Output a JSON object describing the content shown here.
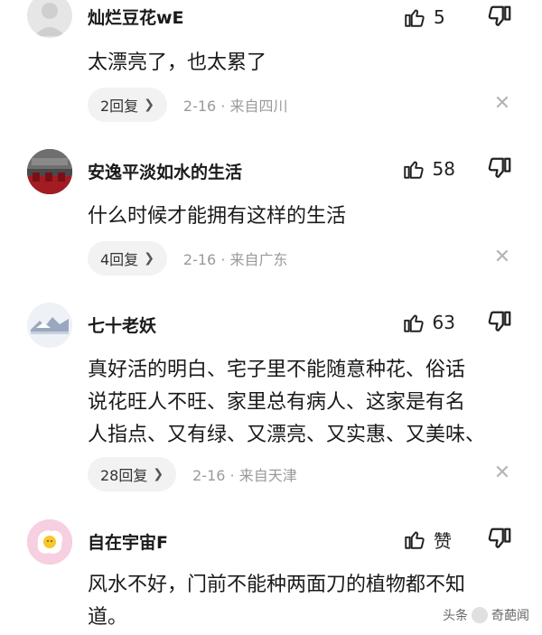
{
  "comments": [
    {
      "username": "灿烂豆花wE",
      "likes": "5",
      "text": [
        "太漂亮了，也太累了"
      ],
      "replies": "2回复",
      "date": "2-16",
      "location": "来自四川",
      "avatar": "gray-placeholder-avatar"
    },
    {
      "username": "安逸平淡如水的生活",
      "likes": "58",
      "text": [
        "什么时候才能拥有这样的生活"
      ],
      "replies": "4回复",
      "date": "2-16",
      "location": "来自广东",
      "avatar": "photo-avatar"
    },
    {
      "username": "七十老妖",
      "likes": "63",
      "text": [
        "真好活的明白、宅子里不能随意种花、俗话",
        "说花旺人不旺、家里总有病人、这家是有名",
        "人指点、又有绿、又漂亮、又实惠、又美味、"
      ],
      "replies": "28回复",
      "date": "2-16",
      "location": "来自天津",
      "avatar": "snow-landscape-avatar"
    },
    {
      "username": "自在宇宙F",
      "likes": "赞",
      "text": [
        "风水不好，门前不能种两面刀的植物都不知",
        "道。"
      ],
      "avatar": "fried-egg-avatar"
    }
  ],
  "separator": "·",
  "watermark": {
    "brand": "头条",
    "account": "奇葩闻"
  },
  "icons": {
    "like": "thumbs-up-icon",
    "dislike": "thumbs-down-icon",
    "close": "close-icon",
    "chevron": "chevron-right-icon"
  }
}
